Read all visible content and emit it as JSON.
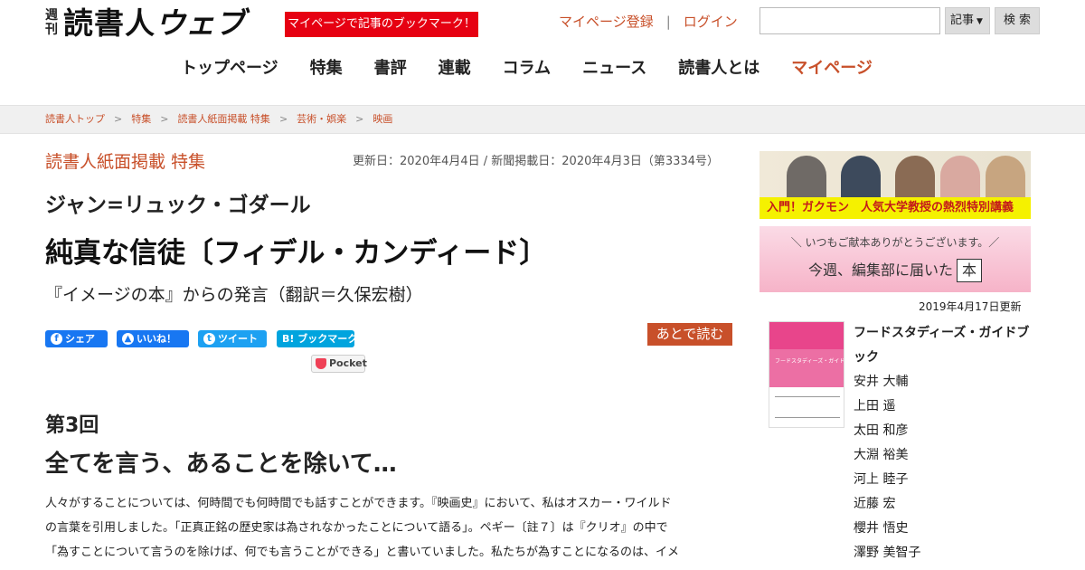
{
  "header": {
    "logo_small": "週刊",
    "logo_main": "読書人",
    "logo_web": "ウェブ",
    "bookmark_banner": "マイページで記事のブックマーク！",
    "register_link": "マイページ登録",
    "separator": "|",
    "login_link": "ログイン",
    "search_placeholder": "",
    "search_select": "記事",
    "search_button": "検 索"
  },
  "nav": {
    "items": [
      "トップページ",
      "特集",
      "書評",
      "連載",
      "コラム",
      "ニュース",
      "読書人とは",
      "マイページ"
    ],
    "active_index": 7
  },
  "breadcrumb": [
    "読書人トップ",
    "特集",
    "読書人紙面掲載 特集",
    "芸術・娯楽",
    "映画"
  ],
  "article": {
    "category": "読書人紙面掲載 特集",
    "dates": "更新日：2020年4月4日 / 新聞掲載日：2020年4月3日（第3334号）",
    "author": "ジャン=リュック・ゴダール",
    "title": "純真な信徒〔フィデル・カンディード〕",
    "subtitle": "『イメージの本』からの発言（翻訳＝久保宏樹）",
    "share": {
      "fb_share": "シェア",
      "fb_like": "いいね！",
      "tweet": "ツイート",
      "hatena": "B! ブックマーク",
      "pocket": "Pocket"
    },
    "read_later": "あとで読む",
    "chapter": "第3回",
    "chapter_title": "全てを言う、あることを除いて…",
    "body": [
      "人々がすることについては、何時間でも何時間でも話すことができます。『映画史』において、私はオスカー・ワイルド",
      "の言葉を引用しました。「正真正銘の歴史家は為されなかったことについて語る」。ペギー〔註７〕は『クリオ』の中で",
      "「為すことについて言うのを除けば、何でも言うことができる」と書いていました。私たちが為すことになるのは、イメ"
    ]
  },
  "sidebar": {
    "ad1_text": "入門！ガクモン　人気大学教授の熱烈特別講義",
    "ad2_line1": "＼ いつもご献本ありがとうございます。／",
    "ad2_line2": "今週、編集部に届いた",
    "ad2_hon": "本",
    "updated": "2019年4月17日更新",
    "book_title": "フードスタディーズ・ガイドブック",
    "cover_title": "フードスタディーズ・ガイドブック",
    "authors": [
      "安井 大輔",
      "上田 遥",
      "太田 和彦",
      "大淵 裕美",
      "河上 睦子",
      "近藤 宏",
      "櫻井 悟史",
      "澤野 美智子"
    ]
  },
  "colors": {
    "accent": "#c8502a",
    "banner_red": "#e60012",
    "facebook": "#1877f2",
    "twitter": "#1da1f2",
    "hatena": "#00a4de"
  }
}
